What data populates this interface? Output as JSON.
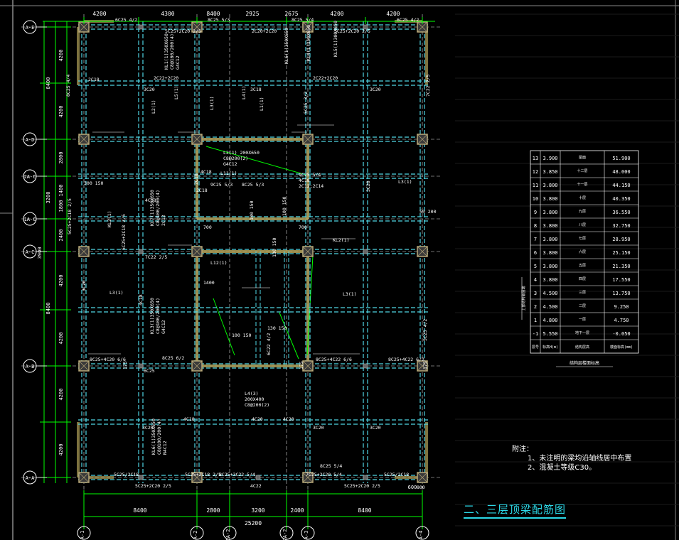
{
  "drawing": {
    "title": "二、三层顶梁配筋图",
    "notes_heading": "附注：",
    "notes": [
      "1、未注明的梁均沿轴线居中布置",
      "2、混凝土等级C30。"
    ],
    "colors": {
      "background": "#000000",
      "dimension": "#00ff00",
      "beam": "#4fd6e4",
      "rebar_text": "#ffffff",
      "axis": "#dddddd",
      "column": "#b8a878",
      "wall": "#b3a35a"
    }
  },
  "top_dims": [
    "4200",
    "4300",
    "8400",
    "2925",
    "2675",
    "4200",
    "4200"
  ],
  "bottom_dims": [
    "8400",
    "2800",
    "3200",
    "2400",
    "8400"
  ],
  "bottom_total": "25200",
  "left_dims_outer": [
    "8400",
    "3200",
    "8400"
  ],
  "left_dims_inner": [
    "4200",
    "4200",
    "2800",
    "1400",
    "1800",
    "2400",
    "4200",
    "4200",
    "4200",
    "4200"
  ],
  "left_dims_extra": [
    "3900",
    "600"
  ],
  "row_axes": [
    "A-E",
    "A-D",
    "2A-C",
    "1A-C",
    "A-C",
    "A-B",
    "A-A"
  ],
  "col_axes": [
    "A-1",
    "A-2",
    "1A-2",
    "2A-2",
    "A-3",
    "A-4"
  ],
  "beam_labels": [
    "6C25 4/2",
    "5C25+2C20 2/5",
    "8C25 5/3",
    "2C20+2C20",
    "8C25 5/4",
    "5C25+2C20 2/5",
    "6C25 4/2",
    "KL1(1)350X650",
    "C8@100/200(4)",
    "G4C12",
    "KL4(1)350X650",
    "KL6(1)350X650",
    "KL5(1)300X650",
    "2C18",
    "2C22+2C20",
    "2C22+2C20",
    "3C20",
    "3C18",
    "3C20",
    "8C25 4/4",
    "7C22 2/5",
    "5C25 3/2",
    "L1(1)",
    "L2(1)",
    "L3(1)",
    "L4(1)",
    "L5(1)",
    "L12(1)",
    "L11(1)",
    "L2(1) 200X650",
    "C8@200(2)",
    "G4C12",
    "9C25 5/3",
    "2C18",
    "4C18",
    "9C25 5/4",
    "4C18",
    "2C12;2C14",
    "L3(1)",
    "3C20",
    "4C18",
    "8C25 5/3",
    "2C18",
    "5C25+2C18 2/5",
    "5C25+2C18 2/5",
    "7C22 2/5",
    "KL7(1)350X650",
    "C8@100/200(4)",
    "2C12",
    "KL2(1)",
    "KL2(1)",
    "3C20",
    "4C18",
    "L3(1)",
    "L3(1)",
    "KL3(1)350X650",
    "C8@100/200(4)",
    "G4C12",
    "8C25+4C20 6/6",
    "6C25",
    "8C25 6/2",
    "6C22 4/2",
    "8C25+4C22 6/6",
    "8C25+4C22 6/2",
    "5C25 4/2",
    "175",
    "175",
    "175",
    "4C18",
    "4C20",
    "4C20",
    "3C20",
    "3C20",
    "3C20",
    "L4(3)",
    "200X400",
    "C8@200(2)",
    "KL6(1)350X650",
    "C8@100/200(4)",
    "N4C12",
    "5C25/2C18",
    "5C25+2C18 2/5",
    "8C25+3C22 5/4",
    "7C25+2C20 5/4",
    "8C25 5/4",
    "5C25/2C18",
    "5C25+2C20 2/5",
    "4C22",
    "5C25+2C20 2/5",
    "300 150",
    "50 200",
    "100 150",
    "100 150",
    "130 150",
    "100 150",
    "130 150",
    "700",
    "700",
    "1400",
    "800"
  ],
  "floor_table": {
    "headers": [
      "层号",
      "标高H(m)",
      "结构层高",
      "楼面标高(mm)"
    ],
    "caption": "结构层楼面标高",
    "side_label": "上部结构嵌固端",
    "rows": [
      {
        "n": "13",
        "h": "3.900",
        "elev": "51.900",
        "tag": "屋面"
      },
      {
        "n": "12",
        "h": "3.850",
        "elev": "48.000",
        "tag": "十二层"
      },
      {
        "n": "11",
        "h": "3.800",
        "elev": "44.150",
        "tag": "十一层"
      },
      {
        "n": "10",
        "h": "3.800",
        "elev": "40.350",
        "tag": "十层"
      },
      {
        "n": "9",
        "h": "3.800",
        "elev": "36.550",
        "tag": "九层"
      },
      {
        "n": "8",
        "h": "3.800",
        "elev": "32.750",
        "tag": "八层"
      },
      {
        "n": "7",
        "h": "3.800",
        "elev": "28.950",
        "tag": "七层"
      },
      {
        "n": "6",
        "h": "3.800",
        "elev": "25.150",
        "tag": "六层"
      },
      {
        "n": "5",
        "h": "3.800",
        "elev": "21.350",
        "tag": "五层"
      },
      {
        "n": "4",
        "h": "3.800",
        "elev": "17.550",
        "tag": "四层"
      },
      {
        "n": "3",
        "h": "4.500",
        "elev": "13.750",
        "tag": "三层"
      },
      {
        "n": "2",
        "h": "4.500",
        "elev": "9.250",
        "tag": "二层"
      },
      {
        "n": "1",
        "h": "4.800",
        "elev": "4.750",
        "tag": "一层"
      },
      {
        "n": "-1",
        "h": "5.550",
        "elev": "-0.050",
        "tag": "地下一层"
      }
    ]
  }
}
